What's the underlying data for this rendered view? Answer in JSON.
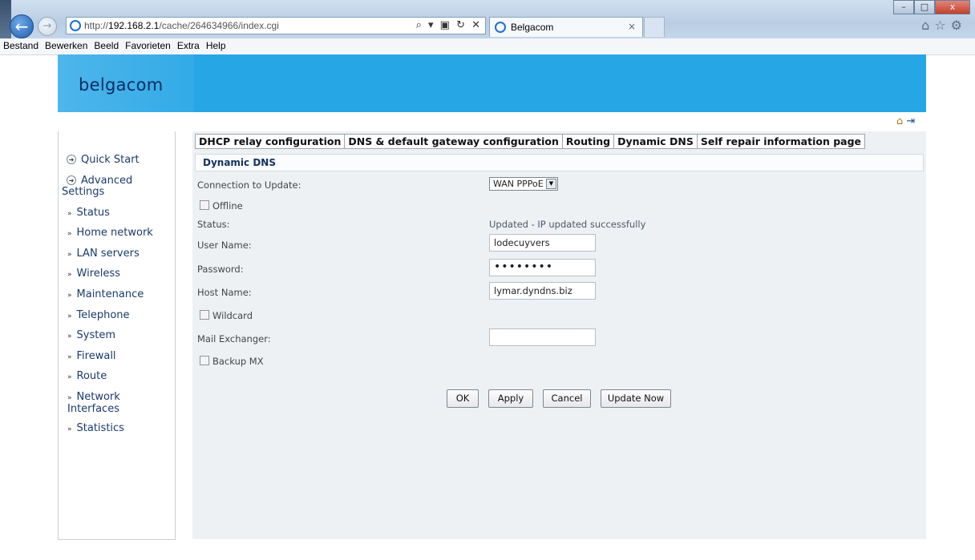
{
  "browser": {
    "url_prefix": "http://",
    "url_host": "192.168.2.1",
    "url_path": "/cache/264634966/index.cgi",
    "url_controls": "⌕ ▾ ▣ ↻ ✕",
    "tab_title": "Belgacom",
    "tab_close": "×",
    "window_buttons": {
      "min": "–",
      "max": "□",
      "close": "x"
    },
    "right_icons": "⌂☆⚙"
  },
  "menubar": [
    "Bestand",
    "Bewerken",
    "Beeld",
    "Favorieten",
    "Extra",
    "Help"
  ],
  "brand": {
    "logo_text": "belgacom",
    "brand_color": "#27a6e6"
  },
  "top_icons": {
    "home": "⌂",
    "logout": "⇥"
  },
  "sidebar": {
    "main": [
      {
        "label": "Quick Start"
      },
      {
        "label_line1": "Advanced",
        "label_line2": "Settings"
      }
    ],
    "sub": [
      {
        "label": "Status"
      },
      {
        "label": "Home network"
      },
      {
        "label": "LAN servers"
      },
      {
        "label": "Wireless"
      },
      {
        "label": "Maintenance"
      },
      {
        "label": "Telephone"
      },
      {
        "label": "System"
      },
      {
        "label": "Firewall"
      },
      {
        "label": "Route"
      },
      {
        "label_line1": "Network",
        "label_line2": "Interfaces"
      },
      {
        "label": "Statistics"
      }
    ],
    "arrow": "»"
  },
  "tabs": [
    "DHCP relay configuration",
    "DNS & default gateway configuration",
    "Routing",
    "Dynamic DNS",
    "Self repair information page"
  ],
  "section_title": "Dynamic DNS",
  "form": {
    "connection_label": "Connection to Update:",
    "connection_value": "WAN PPPoE",
    "offline_label": "Offline",
    "status_label": "Status:",
    "status_value": "Updated  - IP updated successfully",
    "username_label": "User Name:",
    "username_value": "lodecuyvers",
    "password_label": "Password:",
    "password_value": "••••••••",
    "hostname_label": "Host Name:",
    "hostname_value": "lymar.dyndns.biz",
    "wildcard_label": "Wildcard",
    "mail_label": "Mail Exchanger:",
    "mail_value": "",
    "backup_label": "Backup MX"
  },
  "buttons": {
    "ok": "OK",
    "apply": "Apply",
    "cancel": "Cancel",
    "update": "Update Now"
  }
}
